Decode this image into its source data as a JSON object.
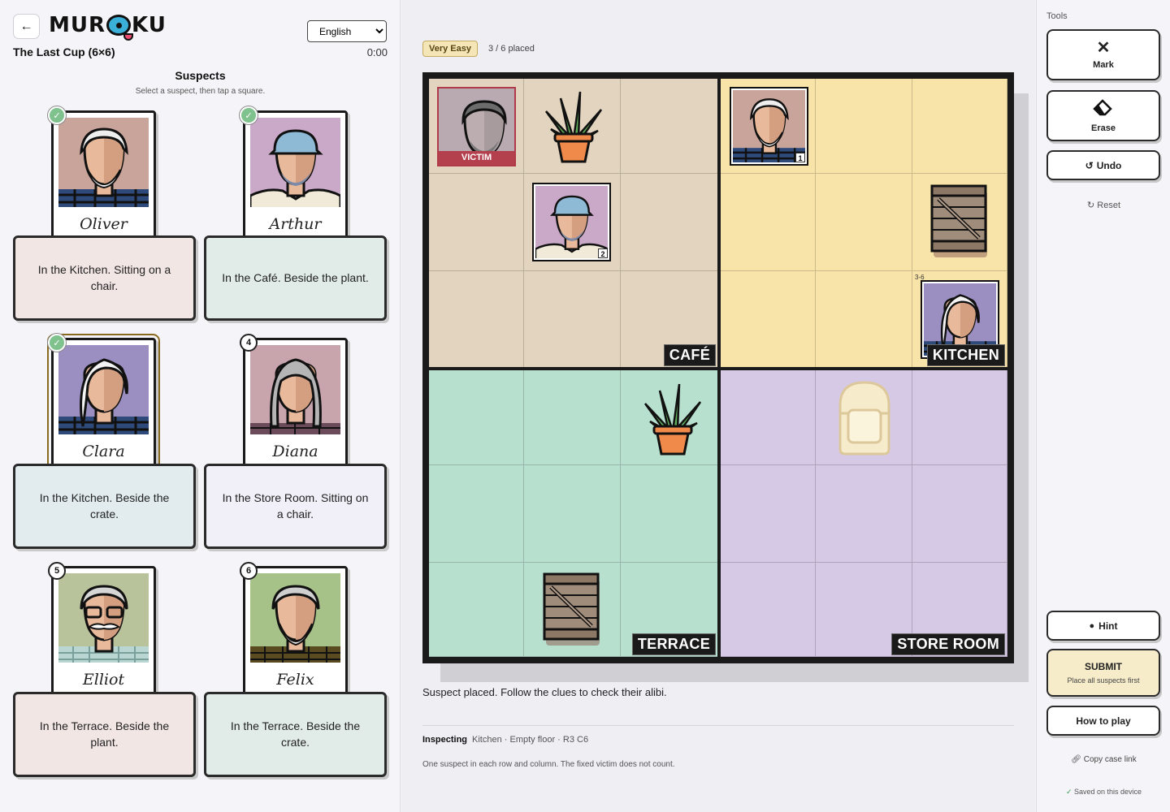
{
  "header": {
    "logo_text_left": "MUR",
    "logo_text_right": "KU",
    "case_title": "The Last Cup (6×6)",
    "language": "English",
    "language_options": [
      "English"
    ],
    "timer": "0:00"
  },
  "suspects_panel": {
    "title": "Suspects",
    "subtitle": "Select a suspect, then tap a square.",
    "suspects": [
      {
        "name": "Oliver",
        "badge": "",
        "placed": true,
        "clue": "In the Kitchen. Sitting on a chair.",
        "bg": "#c8a49a",
        "clue_bg": "#f1e6e4"
      },
      {
        "name": "Arthur",
        "badge": "",
        "placed": true,
        "clue": "In the Café. Beside the plant.",
        "bg": "#c9a8c8",
        "clue_bg": "#e1ebe7"
      },
      {
        "name": "Clara",
        "badge": "",
        "placed": true,
        "selected": true,
        "clue": "In the Kitchen. Beside the crate.",
        "bg": "#9a8fc0",
        "clue_bg": "#e2ecef"
      },
      {
        "name": "Diana",
        "badge": "4",
        "placed": false,
        "clue": "In the Store Room. Sitting on a chair.",
        "bg": "#c8a4ad",
        "clue_bg": "#f1eff7"
      },
      {
        "name": "Elliot",
        "badge": "5",
        "placed": false,
        "clue": "In the Terrace. Beside the plant.",
        "bg": "#b9c39b",
        "clue_bg": "#f1e6e4"
      },
      {
        "name": "Felix",
        "badge": "6",
        "placed": false,
        "clue": "In the Terrace. Beside the crate.",
        "bg": "#a7c289",
        "clue_bg": "#e1ebe7"
      }
    ]
  },
  "board": {
    "difficulty": "Very Easy",
    "placed_count": "3 / 6 placed",
    "rooms": {
      "cafe": {
        "label": "CAFÉ",
        "color": "#e2d4bf"
      },
      "kitchen": {
        "label": "KITCHEN",
        "color": "#f8e3a8"
      },
      "terrace": {
        "label": "TERRACE",
        "color": "#b7e0cf"
      },
      "store_room": {
        "label": "STORE ROOM",
        "color": "#d6c9e6"
      }
    },
    "victim_label": "VICTIM",
    "placed_numbers": [
      "1",
      "2"
    ],
    "coord_note": "3-6",
    "status": "Suspect placed. Follow the clues to check their alibi.",
    "inspecting_label": "Inspecting",
    "inspecting_value": "Kitchen · Empty floor · R3 C6",
    "rule": "One suspect in each row and column. The fixed victim does not count."
  },
  "tools": {
    "label": "Tools",
    "mark": "Mark",
    "erase": "Erase",
    "undo": "Undo",
    "reset": "Reset",
    "hint": "Hint",
    "submit": "SUBMIT",
    "submit_sub": "Place all suspects first",
    "how_to_play": "How to play",
    "copy_link": "Copy case link",
    "saved": "Saved on this device"
  }
}
